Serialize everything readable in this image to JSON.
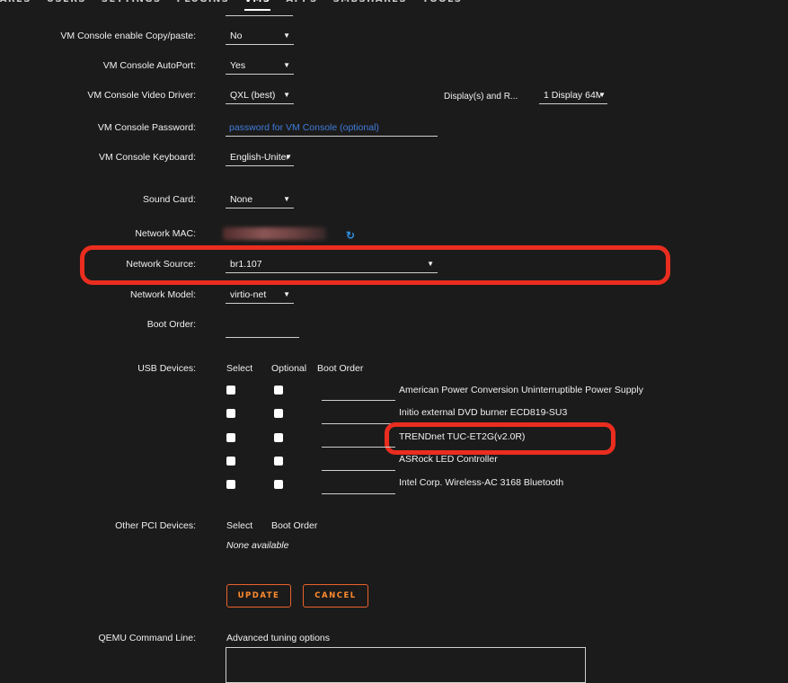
{
  "nav": {
    "items": [
      "HARES",
      "USERS",
      "SETTINGS",
      "PLUGINS",
      "VMS",
      "APPS",
      "SMBSHARES",
      "TOOLS"
    ],
    "active": "VMS"
  },
  "form": {
    "copy_paste": {
      "label": "VM Console enable Copy/paste:",
      "value": "No"
    },
    "autoport": {
      "label": "VM Console AutoPort:",
      "value": "Yes"
    },
    "video_driver": {
      "label": "VM Console Video Driver:",
      "value": "QXL (best)"
    },
    "displays": {
      "label": "Display(s) and R...",
      "value": "1 Display 64M"
    },
    "password": {
      "label": "VM Console Password:",
      "placeholder": "password for VM Console (optional)"
    },
    "keyboard": {
      "label": "VM Console Keyboard:",
      "value": "English-United"
    },
    "sound": {
      "label": "Sound Card:",
      "value": "None"
    },
    "mac": {
      "label": "Network MAC:"
    },
    "network_source": {
      "label": "Network Source:",
      "value": "br1.107"
    },
    "network_model": {
      "label": "Network Model:",
      "value": "virtio-net"
    },
    "boot_order": {
      "label": "Boot Order:"
    },
    "usb": {
      "label": "USB Devices:",
      "col_select": "Select",
      "col_optional": "Optional",
      "col_boot": "Boot Order",
      "devices": [
        "American Power Conversion Uninterruptible Power Supply",
        "Initio external DVD burner ECD819-SU3",
        "TRENDnet TUC-ET2G(v2.0R)",
        "ASRock LED Controller",
        "Intel Corp. Wireless-AC 3168 Bluetooth"
      ]
    },
    "pci": {
      "label": "Other PCI Devices:",
      "col_select": "Select",
      "col_boot": "Boot Order",
      "none": "None available"
    },
    "update_label": "UPDATE",
    "cancel_label": "CANCEL",
    "qemu": {
      "label": "QEMU Command Line:",
      "hint": "Advanced tuning options"
    }
  },
  "colors": {
    "background": "#1c1b1b",
    "highlight": "#ea2d1f",
    "accent": "#ff8c2f",
    "link": "#3f7ddc"
  },
  "icons": {
    "refresh": "refresh-icon",
    "caret": "caret-down-icon"
  }
}
